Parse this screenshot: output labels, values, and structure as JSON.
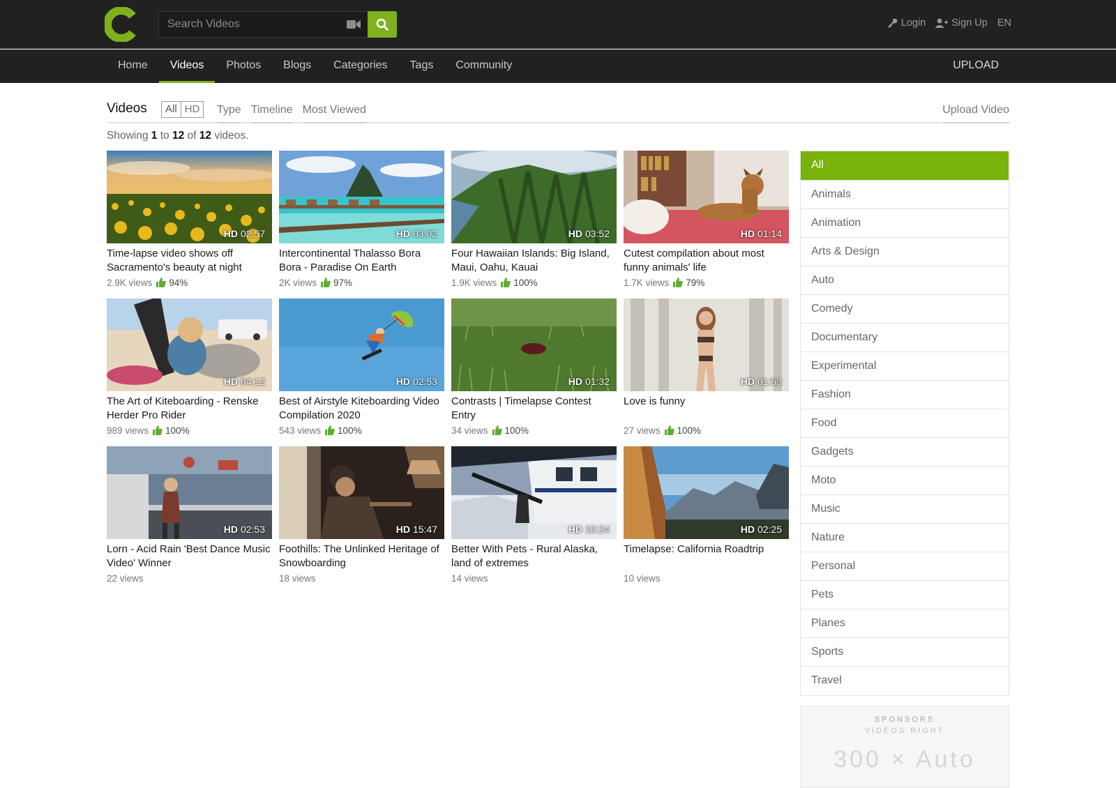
{
  "header": {
    "search_placeholder": "Search Videos",
    "login": "Login",
    "signup": "Sign Up",
    "language": "EN",
    "brand_color": "#7fb01e"
  },
  "nav": {
    "items": [
      "Home",
      "Videos",
      "Photos",
      "Blogs",
      "Categories",
      "Tags",
      "Community"
    ],
    "active": "Videos",
    "upload": "UPLOAD"
  },
  "page": {
    "title": "Videos",
    "toggle_all": "All",
    "toggle_hd": "HD",
    "filters": [
      "Type",
      "Timeline",
      "Most Viewed"
    ],
    "upload_video": "Upload Video",
    "showing_prefix": "Showing",
    "showing_from": "1",
    "showing_to_word": "to",
    "showing_to": "12",
    "showing_of_word": "of",
    "showing_total": "12",
    "showing_suffix": "videos."
  },
  "videos": [
    {
      "hd": "HD",
      "duration": "02:57",
      "title": "Time-lapse video shows off Sacramento's beauty at night",
      "views": "2.9K views",
      "rating": "94%"
    },
    {
      "hd": "HD",
      "duration": "03:02",
      "title": "Intercontinental Thalasso Bora Bora - Paradise On Earth",
      "views": "2K views",
      "rating": "97%"
    },
    {
      "hd": "HD",
      "duration": "03:52",
      "title": "Four Hawaiian Islands: Big Island, Maui, Oahu, Kauai",
      "views": "1.9K views",
      "rating": "100%"
    },
    {
      "hd": "HD",
      "duration": "01:14",
      "title": "Cutest compilation about most funny animals' life",
      "views": "1.7K views",
      "rating": "79%"
    },
    {
      "hd": "HD",
      "duration": "04:12",
      "title": "The Art of Kiteboarding - Renske Herder Pro Rider",
      "views": "989 views",
      "rating": "100%"
    },
    {
      "hd": "HD",
      "duration": "02:53",
      "title": "Best of Airstyle Kiteboarding Video Compilation 2020",
      "views": "543 views",
      "rating": "100%"
    },
    {
      "hd": "HD",
      "duration": "01:32",
      "title": "Contrasts | Timelapse Contest Entry",
      "views": "34 views",
      "rating": "100%"
    },
    {
      "hd": "HD",
      "duration": "01:53",
      "title": "Love is funny",
      "views": "27 views",
      "rating": "100%"
    },
    {
      "hd": "HD",
      "duration": "02:53",
      "title": "Lorn - Acid Rain 'Best Dance Music Video' Winner",
      "views": "22 views",
      "rating": ""
    },
    {
      "hd": "HD",
      "duration": "15:47",
      "title": "Foothills: The Unlinked Heritage of Snowboarding",
      "views": "18 views",
      "rating": ""
    },
    {
      "hd": "HD",
      "duration": "10:24",
      "title": "Better With Pets - Rural Alaska, land of extremes",
      "views": "14 views",
      "rating": ""
    },
    {
      "hd": "HD",
      "duration": "02:25",
      "title": "Timelapse: California Roadtrip",
      "views": "10 views",
      "rating": ""
    }
  ],
  "categories": {
    "active": "All",
    "items": [
      "All",
      "Animals",
      "Animation",
      "Arts & Design",
      "Auto",
      "Comedy",
      "Documentary",
      "Experimental",
      "Fashion",
      "Food",
      "Gadgets",
      "Moto",
      "Music",
      "Nature",
      "Personal",
      "Pets",
      "Planes",
      "Sports",
      "Travel"
    ]
  },
  "sponsor": {
    "line1": "SPONSORS",
    "line2": "VIDEOS RIGHT",
    "size": "300 × Auto"
  }
}
